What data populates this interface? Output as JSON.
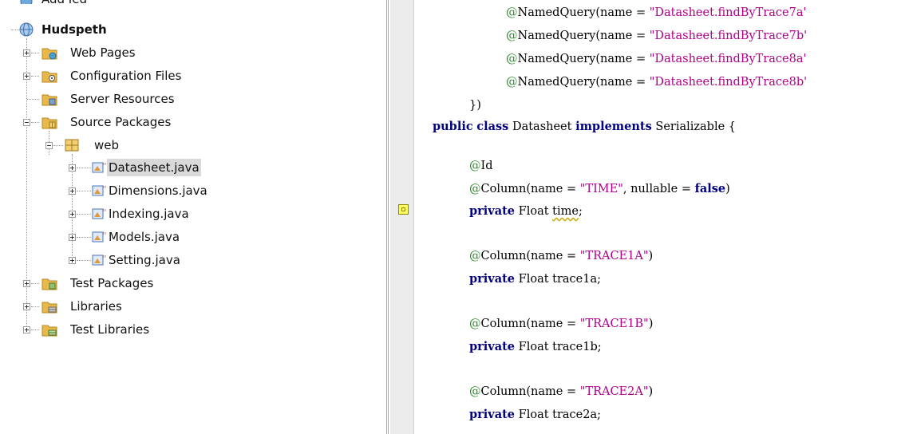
{
  "tree": {
    "prev_item_partial": "Add Ied",
    "project": "Hudspeth",
    "nodes": [
      {
        "label": "Web Pages"
      },
      {
        "label": "Configuration Files"
      },
      {
        "label": "Server Resources"
      },
      {
        "label": "Source Packages"
      },
      {
        "label": "web"
      },
      {
        "label": "Datasheet.java"
      },
      {
        "label": "Dimensions.java"
      },
      {
        "label": "Indexing.java"
      },
      {
        "label": "Models.java"
      },
      {
        "label": "Setting.java"
      },
      {
        "label": "Test Packages"
      },
      {
        "label": "Libraries"
      },
      {
        "label": "Test Libraries"
      }
    ]
  },
  "code": {
    "nq_prefix": "NamedQuery(name = ",
    "nq_at": "@",
    "nq1_str": "\"Datasheet.findByTrace7a'",
    "nq2_str": "\"Datasheet.findByTrace7b'",
    "nq3_str": "\"Datasheet.findByTrace8a'",
    "nq4_str": "\"Datasheet.findByTrace8b'",
    "close_paren": "})",
    "kw_public": "public",
    "kw_class": "class",
    "class_name": " Datasheet ",
    "kw_implements": "implements",
    "implements_rest": " Serializable {",
    "at": "@",
    "id_ann": "Id",
    "col_prefix": "Column(name = ",
    "time_str": "\"TIME\"",
    "nullable_part": ", nullable = ",
    "kw_false": "false",
    "rparen": ")",
    "kw_private": "private",
    "float_type": " Float ",
    "field_time": "time",
    "semi": ";",
    "trace1a_str": "\"TRACE1A\"",
    "field_trace1a": "trace1a;",
    "trace1b_str": "\"TRACE1B\"",
    "field_trace1b": "trace1b;",
    "trace2a_str": "\"TRACE2A\"",
    "field_trace2a": "trace2a;"
  },
  "colors": {
    "keyword": "#000080",
    "string": "#b0008a",
    "annotation_at": "#2e8b2e",
    "hint_marker": "#ffff60",
    "selection": "#d9d9d9"
  }
}
